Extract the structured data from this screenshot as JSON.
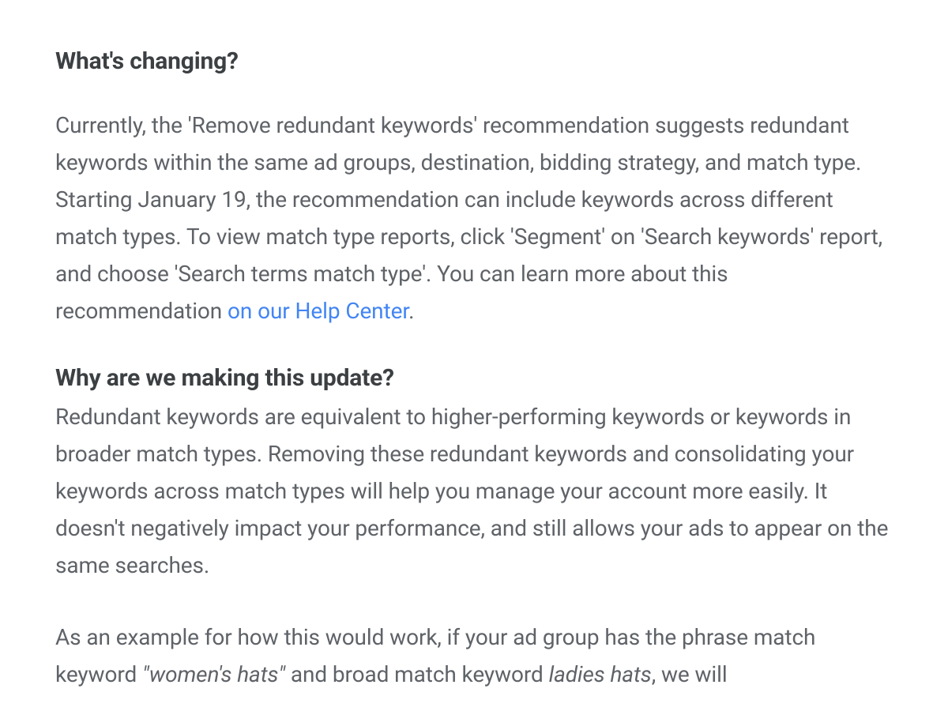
{
  "section1": {
    "heading": "What's changing?",
    "para_part1": "Currently, the 'Remove redundant keywords' recommendation suggests redundant keywords within the same ad groups, destination, bidding strategy, and match type. Starting January 19, the recommendation can include keywords across different match types. To view match type reports, click 'Segment' on 'Search keywords' report, and choose 'Search terms match type'. You can learn more about this recommendation ",
    "link_text": "on our Help Center",
    "para_part2": "."
  },
  "section2": {
    "heading": "Why are we making this update?",
    "para1": "Redundant keywords are equivalent to higher-performing keywords or keywords in broader match types. Removing these redundant keywords and consolidating your keywords across match types will help you manage your account more easily. It doesn't negatively impact your performance, and still allows your ads to appear on the same searches.",
    "para2_part1": "As an example for how this would work, if your ad group has the phrase match keyword ",
    "para2_italic1": "\"women's hats\"",
    "para2_part2": " and broad match keyword ",
    "para2_italic2": "ladies hats",
    "para2_part3": ", we will"
  }
}
